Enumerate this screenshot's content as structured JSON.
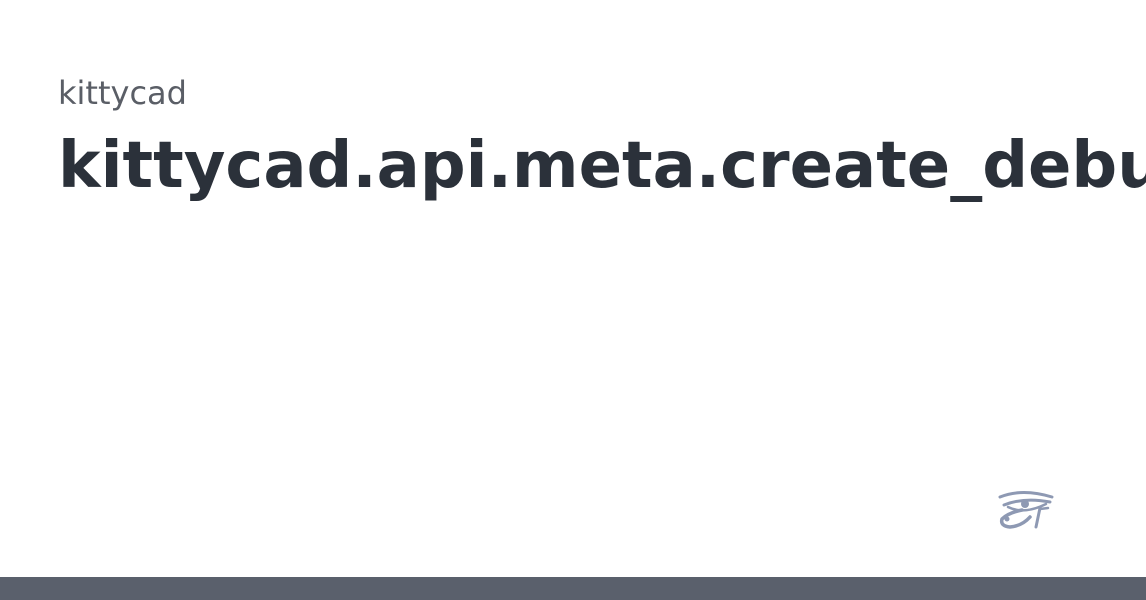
{
  "card": {
    "repo_name": "kittycad",
    "page_title": "kittycad.api.meta.create_debug_uploads"
  },
  "branding": {
    "logo_icon": "eye-of-horus-icon",
    "logo_color": "#8e99b3"
  },
  "colors": {
    "background": "#ffffff",
    "subtitle": "#5a5e66",
    "title": "#2b313a",
    "bottom_bar": "#5a606c"
  }
}
